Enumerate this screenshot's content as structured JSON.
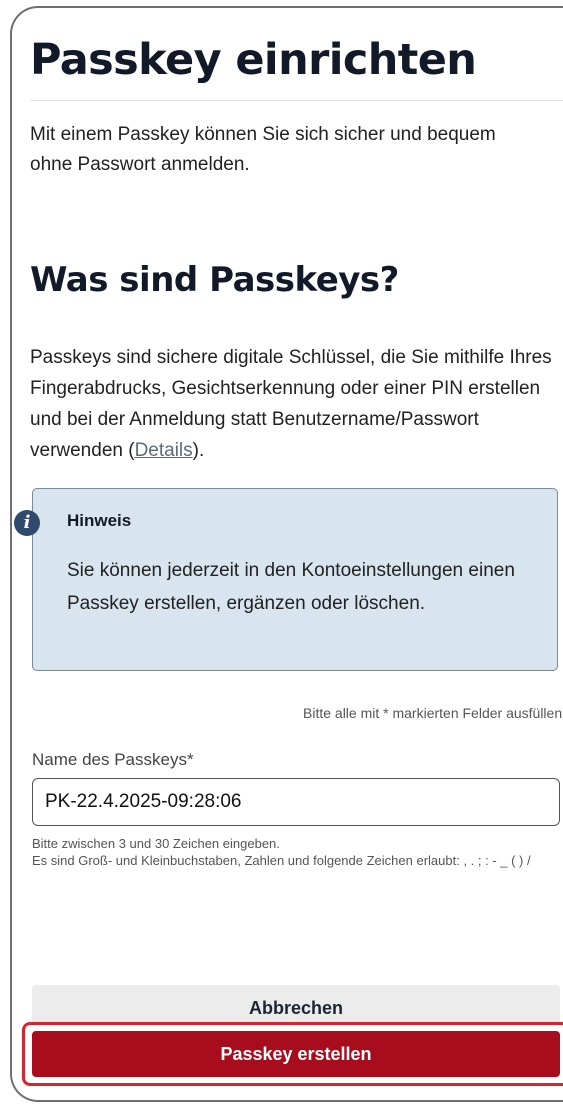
{
  "header": {
    "title": "Passkey einrichten",
    "intro": "Mit einem Passkey können Sie sich sicher und bequem ohne Passwort anmelden."
  },
  "info_section": {
    "title": "Was sind Passkeys?",
    "text_before_link": "Passkeys sind sichere digitale Schlüssel, die Sie mithilfe Ihres Fingerabdrucks, Gesichtserkennung oder einer PIN erstellen und bei der Anmeldung statt Benutzername/Passwort verwenden (",
    "link_label": "Details",
    "text_after_link": ")."
  },
  "hint": {
    "icon": "info-icon",
    "icon_glyph": "i",
    "title": "Hinweis",
    "text": "Sie können jederzeit in den Kontoeinstellungen einen Passkey erstellen, ergänzen oder löschen."
  },
  "form": {
    "required_note": "Bitte alle mit * markierten Felder ausfüllen.",
    "name_label": "Name des Passkeys*",
    "name_value": "PK-22.4.2025-09:28:06",
    "helper_line1": "Bitte zwischen 3 und 30 Zeichen eingeben.",
    "helper_line2": "Es sind Groß- und Kleinbuchstaben, Zahlen und folgende Zeichen erlaubt: , . ; : - _ ( ) /"
  },
  "actions": {
    "cancel_label": "Abbrechen",
    "create_label": "Passkey erstellen"
  },
  "colors": {
    "primary_button": "#a80d1e",
    "highlight_outline": "#d9232f",
    "hint_background": "#d8e4ee",
    "info_icon": "#2f4a6b"
  }
}
